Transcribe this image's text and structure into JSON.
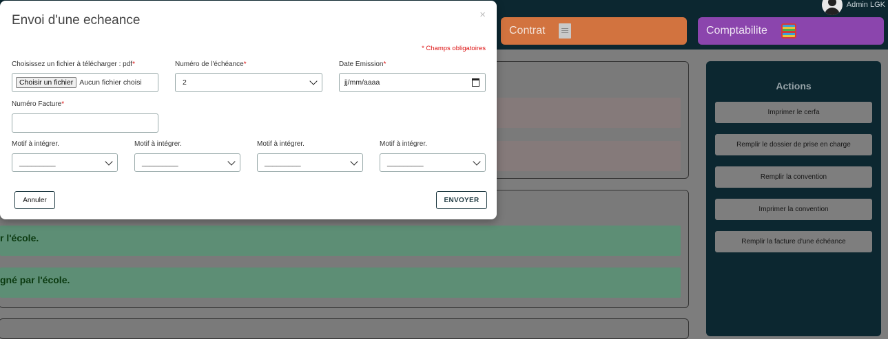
{
  "user": {
    "name": "Admin LGK"
  },
  "nav": {
    "contrat": {
      "label": "Contrat",
      "icon": "document-icon",
      "color": "#d2733f"
    },
    "comptabilite": {
      "label": "Comptabilite",
      "icon": "ledger-icon",
      "color": "#8b45ad"
    }
  },
  "background": {
    "band_texts": [
      "r l'école.",
      "gné par l'école."
    ]
  },
  "sidebar": {
    "title": "Actions",
    "buttons": [
      "Imprimer le cerfa",
      "Remplir le dossier de prise en charge",
      "Remplir la convention",
      "Imprimer la convention",
      "Remplir la facture d'une échéance"
    ]
  },
  "modal": {
    "title": "Envoi d'une echeance",
    "close": "×",
    "required_note": "* Champs obligatoires",
    "file": {
      "label": "Choisissez un fichier à télécharger : pdf",
      "button": "Choisir un fichier",
      "status": "Aucun fichier choisi"
    },
    "echeance": {
      "label": "Numéro de l'échéance",
      "value": "2"
    },
    "date": {
      "label": "Date Emission",
      "placeholder": "jj/mm/aaaa"
    },
    "facture": {
      "label": "Numéro Facture",
      "value": ""
    },
    "motifs": [
      {
        "label": "Motif à intégrer.",
        "value": "_________"
      },
      {
        "label": "Motif à intégrer.",
        "value": "_________"
      },
      {
        "label": "Motif à intégrer.",
        "value": "_________"
      },
      {
        "label": "Motif à intégrer.",
        "value": "_________"
      }
    ],
    "cancel_label": "Annuler",
    "submit_label": "ENVOYER"
  }
}
